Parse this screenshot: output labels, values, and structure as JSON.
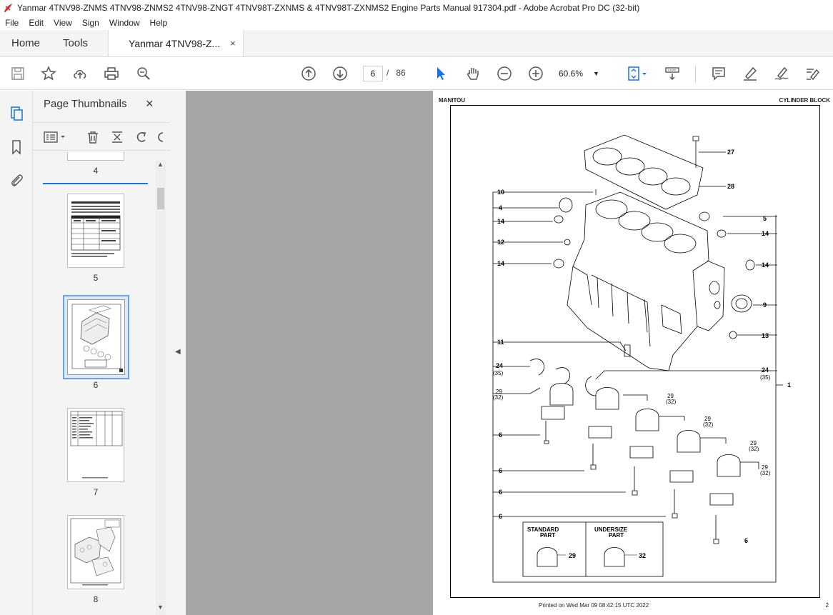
{
  "window": {
    "title": "Yanmar 4TNV98-ZNMS 4TNV98-ZNMS2 4TNV98-ZNGT 4TNV98T-ZXNMS & 4TNV98T-ZXNMS2 Engine Parts Manual 917304.pdf - Adobe Acrobat Pro DC (32-bit)"
  },
  "menu": [
    "File",
    "Edit",
    "View",
    "Sign",
    "Window",
    "Help"
  ],
  "tabs": {
    "home": "Home",
    "tools": "Tools",
    "document": "Yanmar 4TNV98-Z...",
    "close": "×"
  },
  "toolbar": {
    "current_page": "6",
    "page_separator": "/",
    "total_pages": "86",
    "zoom": "60.6%"
  },
  "panel": {
    "title": "Page Thumbnails",
    "close": "×"
  },
  "thumbnails": [
    {
      "label": "4"
    },
    {
      "label": "5"
    },
    {
      "label": "6"
    },
    {
      "label": "7"
    },
    {
      "label": "8"
    }
  ],
  "document": {
    "header_left": "MANITOU",
    "header_right": "CYLINDER BLOCK",
    "footer": "Printed on  Wed Mar 09 08:42:15 UTC 2022",
    "page_number": "2",
    "callouts": {
      "c27": "27",
      "c28": "28",
      "c10": "10",
      "c4": "4",
      "c14a": "14",
      "c12": "12",
      "c14b": "14",
      "c5": "5",
      "c14c": "14",
      "c14d": "14",
      "c9": "9",
      "c13": "13",
      "c11": "11",
      "c24a": "24",
      "c35a": "(35)",
      "c24b": "24",
      "c35b": "(35)",
      "c1": "1",
      "c29a": "29",
      "c32a": "(32)",
      "c29b": "29",
      "c32b": "(32)",
      "c29c": "29",
      "c32c": "(32)",
      "c29d": "29",
      "c32d": "(32)",
      "c29e": "29",
      "c32e": "(32)",
      "c6a": "6",
      "c6b": "6",
      "c6c": "6",
      "c6d": "6",
      "c6e": "6"
    },
    "legend": {
      "standard_line1": "STANDARD",
      "standard_line2": "PART",
      "standard_num": "29",
      "undersize_line1": "UNDERSIZE",
      "undersize_line2": "PART",
      "undersize_num": "32"
    }
  }
}
